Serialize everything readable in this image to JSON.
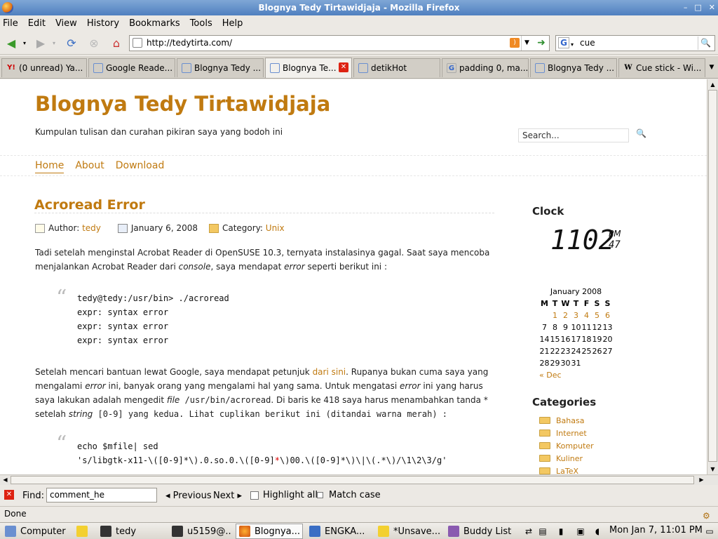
{
  "window": {
    "title": "Blognya Tedy Tirtawidjaja - Mozilla Firefox"
  },
  "menu": [
    "File",
    "Edit",
    "View",
    "History",
    "Bookmarks",
    "Tools",
    "Help"
  ],
  "nav": {
    "url": "http://tedytirta.com/",
    "search_value": "cue"
  },
  "tabs": [
    {
      "label": "(0 unread) Ya...",
      "icon": "yahoo-icon"
    },
    {
      "label": "Google Reade...",
      "icon": "google-reader-icon"
    },
    {
      "label": "Blognya Tedy ...",
      "icon": "blog-icon"
    },
    {
      "label": "Blognya Te...",
      "icon": "blog-icon",
      "active": true
    },
    {
      "label": "detikHot",
      "icon": "page-icon"
    },
    {
      "label": "padding 0, ma...",
      "icon": "google-icon"
    },
    {
      "label": "Blognya Tedy ...",
      "icon": "blog-icon"
    },
    {
      "label": "Cue stick - Wi...",
      "icon": "wikipedia-icon"
    }
  ],
  "blog": {
    "title": "Blognya Tedy Tirtawidjaja",
    "tagline": "Kumpulan tulisan dan curahan pikiran saya yang bodoh ini",
    "search_placeholder": "Search...",
    "nav": [
      "Home",
      "About",
      "Download"
    ]
  },
  "post": {
    "title": "Acroread Error",
    "author_label": "Author:",
    "author": "tedy",
    "date": "January 6, 2008",
    "category_label": "Category:",
    "category": "Unix",
    "para1_a": "Tadi setelah menginstal Acrobat Reader di OpenSUSE 10.3, ternyata instalasinya gagal. Saat saya mencoba menjalankan Acrobat Reader dari ",
    "para1_console": "console",
    "para1_b": ", saya mendapat ",
    "para1_error": "error",
    "para1_c": " seperti berikut ini :",
    "code1": [
      "tedy@tedy:/usr/bin> ./acroread",
      "expr: syntax error",
      "expr: syntax error",
      "expr: syntax error"
    ],
    "para2_a": "Setelah mencari bantuan lewat Google, saya mendapat petunjuk ",
    "para2_link": "dari sini",
    "para2_b": ". Rupanya bukan cuma saya yang mengalami ",
    "para2_error1": "error",
    "para2_c": " ini, banyak orang yang mengalami hal yang sama. Untuk mengatasi ",
    "para2_error2": "error",
    "para2_d": " ini yang harus saya lakukan adalah mengedit ",
    "para2_file": "file",
    "para2_path": " /usr/bin/acroread",
    "para2_e": ". Di baris ke 418 saya harus menambahkan tanda * setelah ",
    "para2_string": "string",
    "para2_f": " [0-9] yang kedua. Lihat cuplikan berikut ini (ditandai warna merah) :",
    "code2_line1": "echo $mfile| sed",
    "code2_line2a": "'s/libgtk-x11-\\([0-9]*\\).0.so.0.\\([0-9]",
    "code2_line2b": "*",
    "code2_line2c": "\\)00.\\([0-9]*\\)\\|\\(.*\\)/\\1\\2\\3/g'"
  },
  "sidebar": {
    "clock_title": "Clock",
    "clock_time": "1102",
    "clock_ampm": "PM",
    "clock_sec": "47",
    "cal_caption": "January 2008",
    "cal_days": [
      "M",
      "T",
      "W",
      "T",
      "F",
      "S",
      "S"
    ],
    "cal_weeks": [
      [
        "",
        "1",
        "2",
        "3",
        "4",
        "5",
        "6"
      ],
      [
        "7",
        "8",
        "9",
        "10",
        "11",
        "12",
        "13"
      ],
      [
        "14",
        "15",
        "16",
        "17",
        "18",
        "19",
        "20"
      ],
      [
        "21",
        "22",
        "23",
        "24",
        "25",
        "26",
        "27"
      ],
      [
        "28",
        "29",
        "30",
        "31",
        "",
        "",
        ""
      ]
    ],
    "cal_prev": "« Dec",
    "cat_title": "Categories",
    "categories": [
      "Bahasa",
      "Internet",
      "Komputer",
      "Kuliner",
      "LaTeX"
    ]
  },
  "findbar": {
    "label": "Find:",
    "value": "comment_he",
    "prev": "Previous",
    "next": "Next",
    "highlight": "Highlight all",
    "matchcase": "Match case"
  },
  "status": {
    "text": "Done"
  },
  "taskbar": {
    "items": [
      "Computer",
      "tedy",
      "u5159@...",
      "Blognya...",
      "ENGKA...",
      "*Unsave...",
      "Buddy List"
    ],
    "clock": "Mon Jan  7, 11:01 PM"
  }
}
